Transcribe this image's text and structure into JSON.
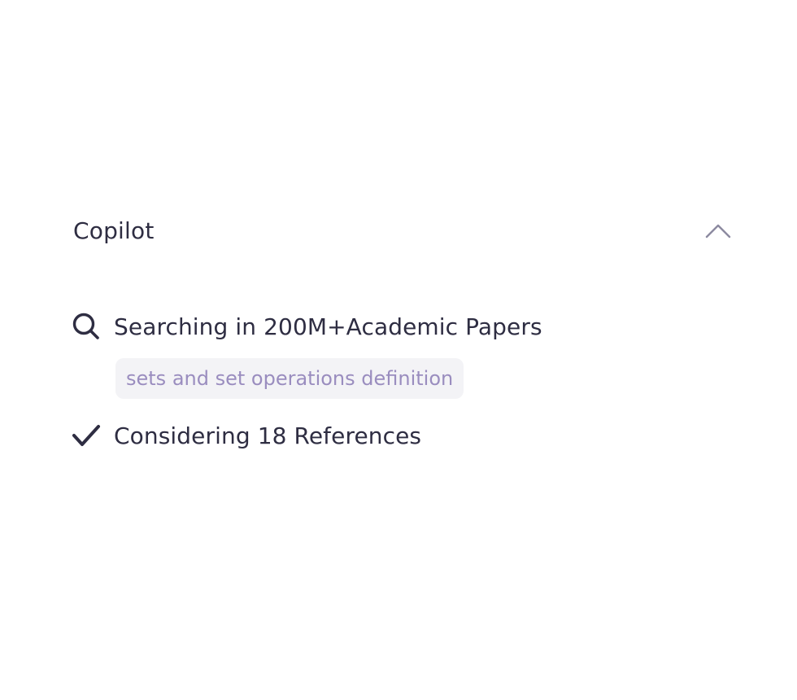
{
  "copilot": {
    "title": "Copilot",
    "collapse_icon": "chevron-up-icon"
  },
  "steps": [
    {
      "icon": "search-icon",
      "label": "Searching in 200M+Academic Papers",
      "query_chip": "sets and set operations definition"
    },
    {
      "icon": "check-icon",
      "label": "Considering 18 References"
    }
  ],
  "colors": {
    "text": "#2e2d42",
    "chip_bg": "#f3f3f6",
    "chip_text": "#9a8dbf",
    "chevron": "#8c8aa0"
  }
}
